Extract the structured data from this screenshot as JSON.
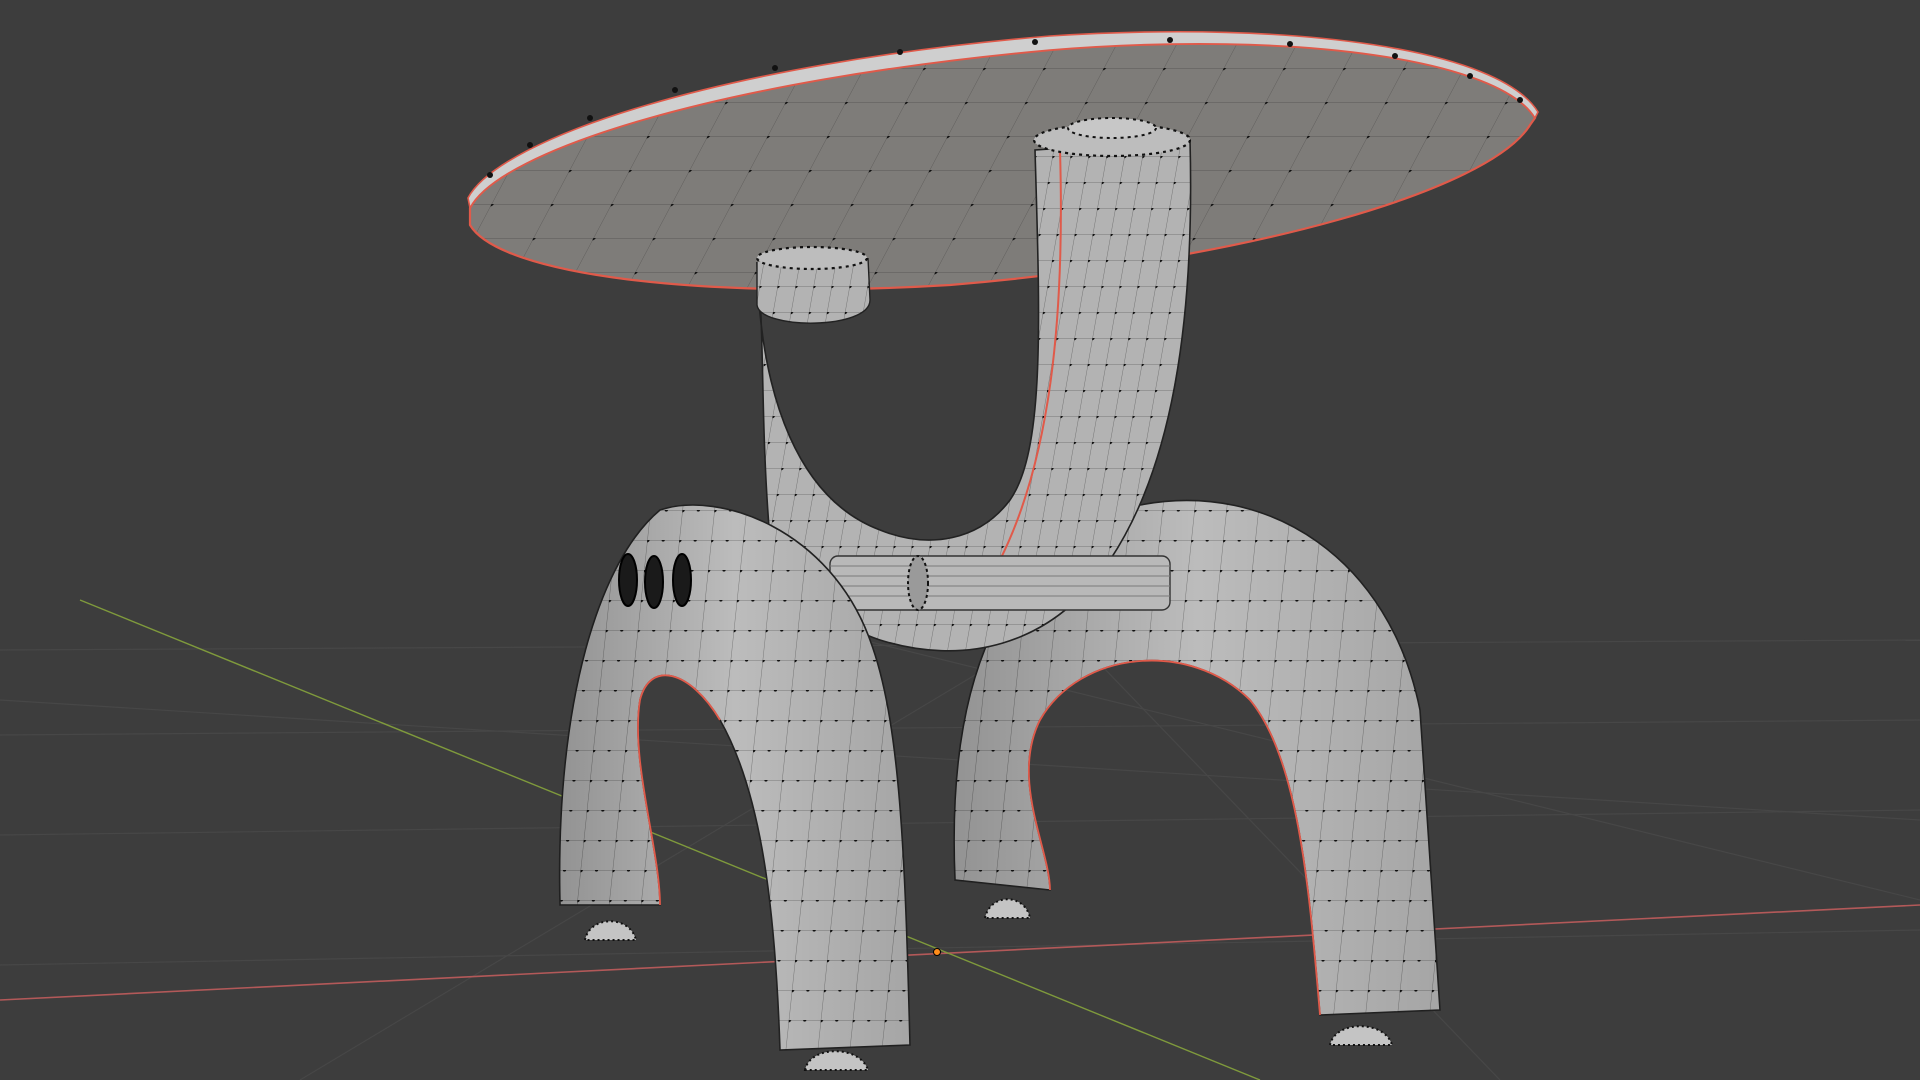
{
  "viewport": {
    "editor": "3d-viewport",
    "mode": "edit-mode",
    "background_color": "#3d3d3d",
    "grid_color": "#4a4a4a",
    "x_axis_color": "#b35959",
    "y_axis_color": "#7f9a3c",
    "mesh_fill_color": "#b9b9b9",
    "mesh_top_color": "#7d7b78",
    "wire_color": "#6b6b6b",
    "vertex_color": "#111111",
    "seam_color": "#e05a4a",
    "origin_color": "#ff8c1a"
  },
  "model": {
    "object": "table",
    "parts": [
      "tabletop",
      "curved-support",
      "arch-leg-left",
      "arch-leg-right",
      "crossbar",
      "feet"
    ]
  }
}
